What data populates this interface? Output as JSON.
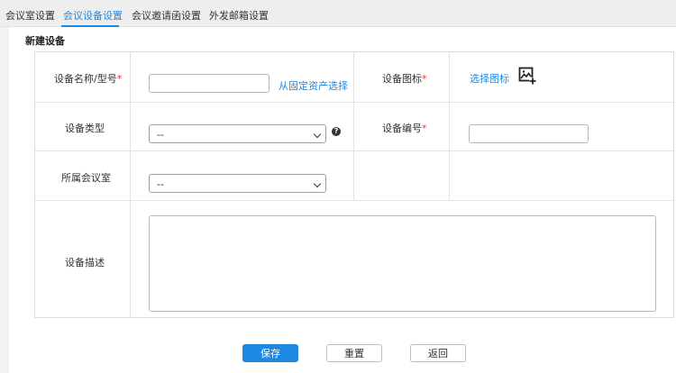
{
  "tabs": [
    {
      "label": "会议室设置",
      "active": false
    },
    {
      "label": "会议设备设置",
      "active": true
    },
    {
      "label": "会议邀请函设置",
      "active": false
    },
    {
      "label": "外发邮箱设置",
      "active": false
    }
  ],
  "section_title": "新建设备",
  "form": {
    "device_name_label": "设备名称/型号",
    "device_name_value": "",
    "asset_link": "从固定资产选择",
    "icon_label": "设备图标",
    "choose_icon_link": "选择图标",
    "type_label": "设备类型",
    "type_value": "--",
    "number_label": "设备编号",
    "number_value": "",
    "room_label": "所属会议室",
    "room_value": "--",
    "desc_label": "设备描述",
    "required_mark": "*",
    "help_glyph": "?"
  },
  "buttons": {
    "save": "保存",
    "reset": "重置",
    "back": "返回"
  },
  "colors": {
    "accent": "#1e88e5",
    "required": "#e53935"
  }
}
